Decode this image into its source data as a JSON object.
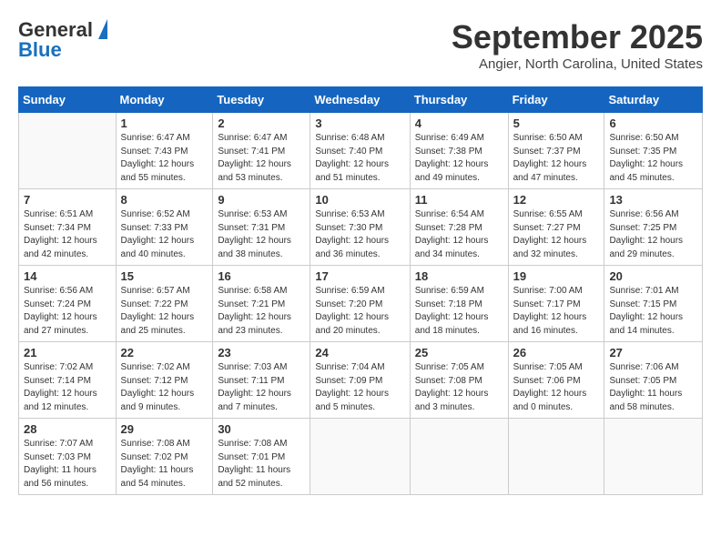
{
  "header": {
    "logo_line1": "General",
    "logo_line2": "Blue",
    "month": "September 2025",
    "location": "Angier, North Carolina, United States"
  },
  "days_of_week": [
    "Sunday",
    "Monday",
    "Tuesday",
    "Wednesday",
    "Thursday",
    "Friday",
    "Saturday"
  ],
  "weeks": [
    [
      {
        "num": "",
        "info": ""
      },
      {
        "num": "1",
        "info": "Sunrise: 6:47 AM\nSunset: 7:43 PM\nDaylight: 12 hours\nand 55 minutes."
      },
      {
        "num": "2",
        "info": "Sunrise: 6:47 AM\nSunset: 7:41 PM\nDaylight: 12 hours\nand 53 minutes."
      },
      {
        "num": "3",
        "info": "Sunrise: 6:48 AM\nSunset: 7:40 PM\nDaylight: 12 hours\nand 51 minutes."
      },
      {
        "num": "4",
        "info": "Sunrise: 6:49 AM\nSunset: 7:38 PM\nDaylight: 12 hours\nand 49 minutes."
      },
      {
        "num": "5",
        "info": "Sunrise: 6:50 AM\nSunset: 7:37 PM\nDaylight: 12 hours\nand 47 minutes."
      },
      {
        "num": "6",
        "info": "Sunrise: 6:50 AM\nSunset: 7:35 PM\nDaylight: 12 hours\nand 45 minutes."
      }
    ],
    [
      {
        "num": "7",
        "info": "Sunrise: 6:51 AM\nSunset: 7:34 PM\nDaylight: 12 hours\nand 42 minutes."
      },
      {
        "num": "8",
        "info": "Sunrise: 6:52 AM\nSunset: 7:33 PM\nDaylight: 12 hours\nand 40 minutes."
      },
      {
        "num": "9",
        "info": "Sunrise: 6:53 AM\nSunset: 7:31 PM\nDaylight: 12 hours\nand 38 minutes."
      },
      {
        "num": "10",
        "info": "Sunrise: 6:53 AM\nSunset: 7:30 PM\nDaylight: 12 hours\nand 36 minutes."
      },
      {
        "num": "11",
        "info": "Sunrise: 6:54 AM\nSunset: 7:28 PM\nDaylight: 12 hours\nand 34 minutes."
      },
      {
        "num": "12",
        "info": "Sunrise: 6:55 AM\nSunset: 7:27 PM\nDaylight: 12 hours\nand 32 minutes."
      },
      {
        "num": "13",
        "info": "Sunrise: 6:56 AM\nSunset: 7:25 PM\nDaylight: 12 hours\nand 29 minutes."
      }
    ],
    [
      {
        "num": "14",
        "info": "Sunrise: 6:56 AM\nSunset: 7:24 PM\nDaylight: 12 hours\nand 27 minutes."
      },
      {
        "num": "15",
        "info": "Sunrise: 6:57 AM\nSunset: 7:22 PM\nDaylight: 12 hours\nand 25 minutes."
      },
      {
        "num": "16",
        "info": "Sunrise: 6:58 AM\nSunset: 7:21 PM\nDaylight: 12 hours\nand 23 minutes."
      },
      {
        "num": "17",
        "info": "Sunrise: 6:59 AM\nSunset: 7:20 PM\nDaylight: 12 hours\nand 20 minutes."
      },
      {
        "num": "18",
        "info": "Sunrise: 6:59 AM\nSunset: 7:18 PM\nDaylight: 12 hours\nand 18 minutes."
      },
      {
        "num": "19",
        "info": "Sunrise: 7:00 AM\nSunset: 7:17 PM\nDaylight: 12 hours\nand 16 minutes."
      },
      {
        "num": "20",
        "info": "Sunrise: 7:01 AM\nSunset: 7:15 PM\nDaylight: 12 hours\nand 14 minutes."
      }
    ],
    [
      {
        "num": "21",
        "info": "Sunrise: 7:02 AM\nSunset: 7:14 PM\nDaylight: 12 hours\nand 12 minutes."
      },
      {
        "num": "22",
        "info": "Sunrise: 7:02 AM\nSunset: 7:12 PM\nDaylight: 12 hours\nand 9 minutes."
      },
      {
        "num": "23",
        "info": "Sunrise: 7:03 AM\nSunset: 7:11 PM\nDaylight: 12 hours\nand 7 minutes."
      },
      {
        "num": "24",
        "info": "Sunrise: 7:04 AM\nSunset: 7:09 PM\nDaylight: 12 hours\nand 5 minutes."
      },
      {
        "num": "25",
        "info": "Sunrise: 7:05 AM\nSunset: 7:08 PM\nDaylight: 12 hours\nand 3 minutes."
      },
      {
        "num": "26",
        "info": "Sunrise: 7:05 AM\nSunset: 7:06 PM\nDaylight: 12 hours\nand 0 minutes."
      },
      {
        "num": "27",
        "info": "Sunrise: 7:06 AM\nSunset: 7:05 PM\nDaylight: 11 hours\nand 58 minutes."
      }
    ],
    [
      {
        "num": "28",
        "info": "Sunrise: 7:07 AM\nSunset: 7:03 PM\nDaylight: 11 hours\nand 56 minutes."
      },
      {
        "num": "29",
        "info": "Sunrise: 7:08 AM\nSunset: 7:02 PM\nDaylight: 11 hours\nand 54 minutes."
      },
      {
        "num": "30",
        "info": "Sunrise: 7:08 AM\nSunset: 7:01 PM\nDaylight: 11 hours\nand 52 minutes."
      },
      {
        "num": "",
        "info": ""
      },
      {
        "num": "",
        "info": ""
      },
      {
        "num": "",
        "info": ""
      },
      {
        "num": "",
        "info": ""
      }
    ]
  ]
}
